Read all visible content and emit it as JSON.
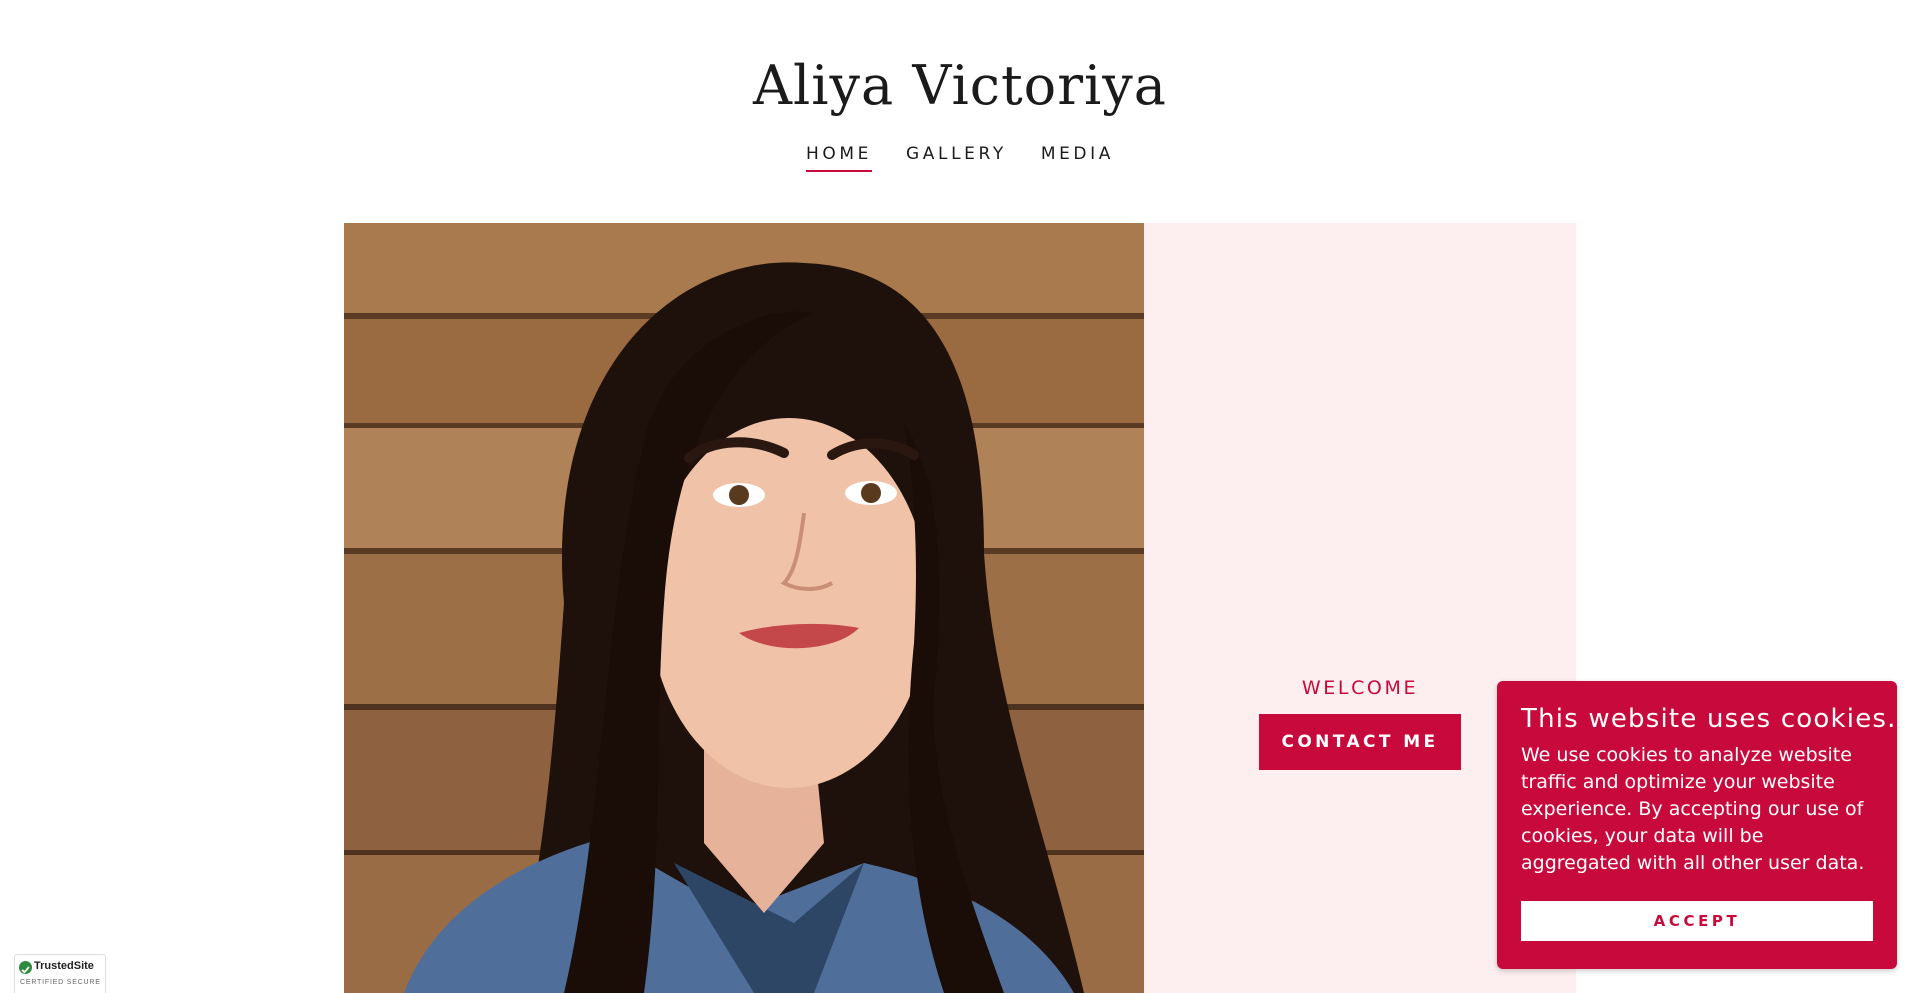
{
  "site": {
    "title": "Aliya Victoriya"
  },
  "nav": {
    "items": [
      {
        "label": "HOME",
        "active": true
      },
      {
        "label": "GALLERY",
        "active": false
      },
      {
        "label": "MEDIA",
        "active": false
      }
    ]
  },
  "hero": {
    "welcome": "WELCOME",
    "contact_label": "CONTACT ME",
    "photo": "portrait photo of a smiling woman with long dark hair in a denim jacket against a wooden wall"
  },
  "cookie": {
    "title": "This website uses cookies.",
    "text": "We use cookies to analyze website traffic and optimize your website experience. By accepting our use of cookies, your data will be aggregated with all other user data.",
    "accept_label": "ACCEPT"
  },
  "badge": {
    "name_part1": "TrustedSite",
    "subtitle": "CERTIFIED SECURE"
  },
  "colors": {
    "accent": "#c8093b",
    "panel_bg": "#fdeff0",
    "text": "#1b1b1b"
  }
}
